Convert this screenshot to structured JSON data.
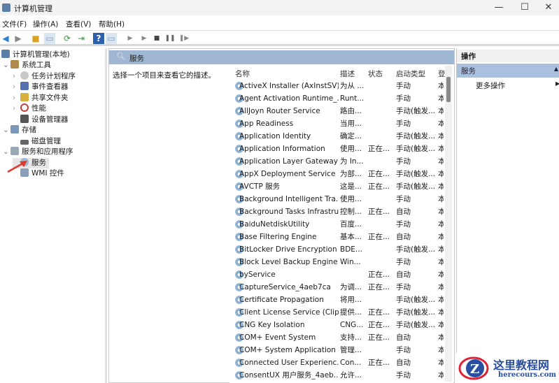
{
  "window": {
    "title": "计算机管理",
    "minimize": "—",
    "maximize": "☐",
    "close": "✕"
  },
  "menu": [
    "文件(F)",
    "操作(A)",
    "查看(V)",
    "帮助(H)"
  ],
  "toolbar_icons": [
    "back-icon",
    "forward-icon",
    "up-folder-icon",
    "show-hide-tree-icon",
    "refresh-icon",
    "export-icon",
    "help-icon",
    "properties-icon",
    "play-icon",
    "play-alt-icon",
    "stop-icon",
    "pause-icon",
    "restart-icon"
  ],
  "tree": {
    "root": "计算机管理(本地)",
    "items": [
      {
        "label": "系统工具",
        "level": 1,
        "expander": "⌄"
      },
      {
        "label": "任务计划程序",
        "level": 2,
        "expander": "›"
      },
      {
        "label": "事件查看器",
        "level": 2,
        "expander": "›"
      },
      {
        "label": "共享文件夹",
        "level": 2,
        "expander": "›"
      },
      {
        "label": "性能",
        "level": 2,
        "expander": "›"
      },
      {
        "label": "设备管理器",
        "level": 2,
        "expander": ""
      },
      {
        "label": "存储",
        "level": 1,
        "expander": "⌄"
      },
      {
        "label": "磁盘管理",
        "level": 2,
        "expander": ""
      },
      {
        "label": "服务和应用程序",
        "level": 1,
        "expander": "⌄"
      },
      {
        "label": "服务",
        "level": 2,
        "expander": ""
      },
      {
        "label": "WMI 控件",
        "level": 2,
        "expander": ""
      }
    ]
  },
  "middle": {
    "title": "服务",
    "description": "选择一个项目来查看它的描述。",
    "columns": [
      "名称",
      "描述",
      "状态",
      "启动类型",
      "登"
    ],
    "rows": [
      [
        "ActiveX Installer (AxInstSV)",
        "为从 ...",
        "",
        "手动",
        "本"
      ],
      [
        "Agent Activation Runtime_...",
        "Runt...",
        "",
        "手动",
        "本"
      ],
      [
        "AllJoyn Router Service",
        "路由...",
        "",
        "手动(触发...",
        "本"
      ],
      [
        "App Readiness",
        "当用...",
        "",
        "手动",
        "本"
      ],
      [
        "Application Identity",
        "确定...",
        "",
        "手动(触发...",
        "本"
      ],
      [
        "Application Information",
        "使用...",
        "正在...",
        "手动(触发...",
        "本"
      ],
      [
        "Application Layer Gateway ...",
        "为 In...",
        "",
        "手动",
        "本"
      ],
      [
        "AppX Deployment Service ...",
        "为部...",
        "正在...",
        "手动(触发...",
        "本"
      ],
      [
        "AVCTP 服务",
        "这是...",
        "正在...",
        "手动(触发...",
        "本"
      ],
      [
        "Background Intelligent Tra...",
        "使用...",
        "",
        "手动",
        "本"
      ],
      [
        "Background Tasks Infrastru...",
        "控制...",
        "正在...",
        "自动",
        "本"
      ],
      [
        "BaiduNetdiskUtility",
        "百度...",
        "",
        "手动",
        "本"
      ],
      [
        "Base Filtering Engine",
        "基本...",
        "正在...",
        "自动",
        "本"
      ],
      [
        "BitLocker Drive Encryption ...",
        "BDE...",
        "",
        "手动(触发...",
        "本"
      ],
      [
        "Block Level Backup Engine ...",
        "Win...",
        "",
        "手动",
        "本"
      ],
      [
        "byService",
        "",
        "正在...",
        "自动",
        "本"
      ],
      [
        "CaptureService_4aeb7ca",
        "为调...",
        "正在...",
        "手动",
        "本"
      ],
      [
        "Certificate Propagation",
        "将用...",
        "",
        "手动(触发...",
        "本"
      ],
      [
        "Client License Service (Clip...",
        "提供...",
        "正在...",
        "手动(触发...",
        "本"
      ],
      [
        "CNG Key Isolation",
        "CNG...",
        "正在...",
        "手动(触发...",
        "本"
      ],
      [
        "COM+ Event System",
        "支持...",
        "正在...",
        "自动",
        "本"
      ],
      [
        "COM+ System Application",
        "管理...",
        "",
        "手动",
        "本"
      ],
      [
        "Connected User Experienc...",
        "Con...",
        "正在...",
        "自动",
        "本"
      ],
      [
        "ConsentUX 用户服务_4aeb...",
        "允许...",
        "",
        "手动",
        "本"
      ]
    ]
  },
  "actions": {
    "header": "操作",
    "section": "服务",
    "more": "更多操作"
  },
  "watermark": {
    "name": "这里教程网",
    "url": "herecours.com"
  },
  "colors": {
    "header_blue": "#9fb7d3",
    "selected_action": "#a9c1de",
    "arrow": "#e03a2e"
  }
}
